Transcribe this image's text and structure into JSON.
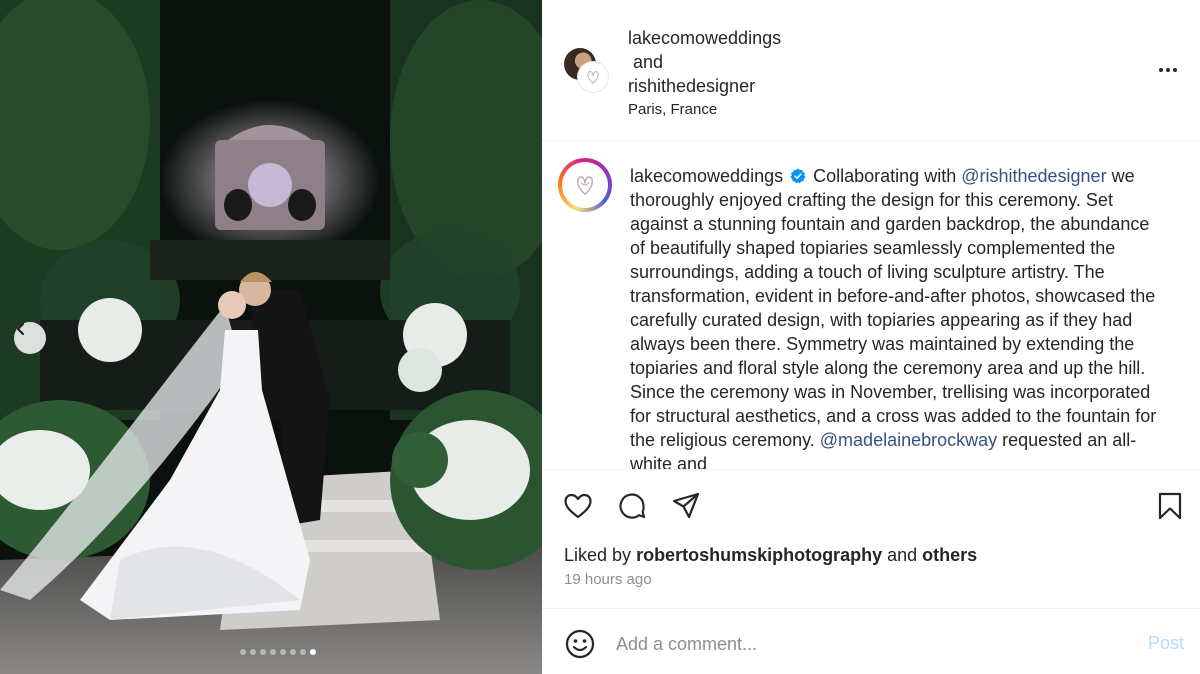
{
  "post": {
    "header": {
      "user1": "lakecomoweddings",
      "and_text": "and",
      "user2": "rishithedesigner",
      "location": "Paris, France",
      "more_icon": "more-horizontal-icon"
    },
    "caption": {
      "username": "lakecomoweddings",
      "verified_icon": "verified-badge-icon",
      "intro": "Collaborating with",
      "mention1": "@rishithedesigner",
      "body1": "we thoroughly enjoyed crafting the design for this ceremony. Set against a stunning fountain and garden backdrop, the abundance of beautifully shaped topiaries seamlessly complemented the surroundings, adding a touch of living sculpture artistry. The transformation, evident in before-and-after photos, showcased the carefully curated design, with topiaries appearing as if they had always been there. Symmetry was maintained by extending the topiaries and floral style along the ceremony area and up the hill. Since the ceremony was in November, trellising was incorporated for structural aesthetics, and a cross was added to the fountain for the religious ceremony.",
      "mention2": "@madelainebrockway",
      "body2": "requested an all-white and"
    },
    "actions": {
      "like_icon": "heart-icon",
      "comment_icon": "comment-bubble-icon",
      "share_icon": "paper-plane-icon",
      "save_icon": "bookmark-icon"
    },
    "likes": {
      "prefix": "Liked by",
      "user": "robertoshumskiphotography",
      "joiner": "and",
      "others": "others"
    },
    "time_ago": "19 hours ago",
    "comment": {
      "placeholder": "Add a comment...",
      "post_label": "Post",
      "emoji_icon": "smiley-icon"
    },
    "carousel": {
      "total": 8,
      "current": 8,
      "prev_icon": "chevron-left-icon"
    }
  },
  "colors": {
    "mention": "#385185",
    "verified": "#0095f6",
    "post_disabled": "#b3dbff",
    "muted": "#8e8e8e"
  }
}
